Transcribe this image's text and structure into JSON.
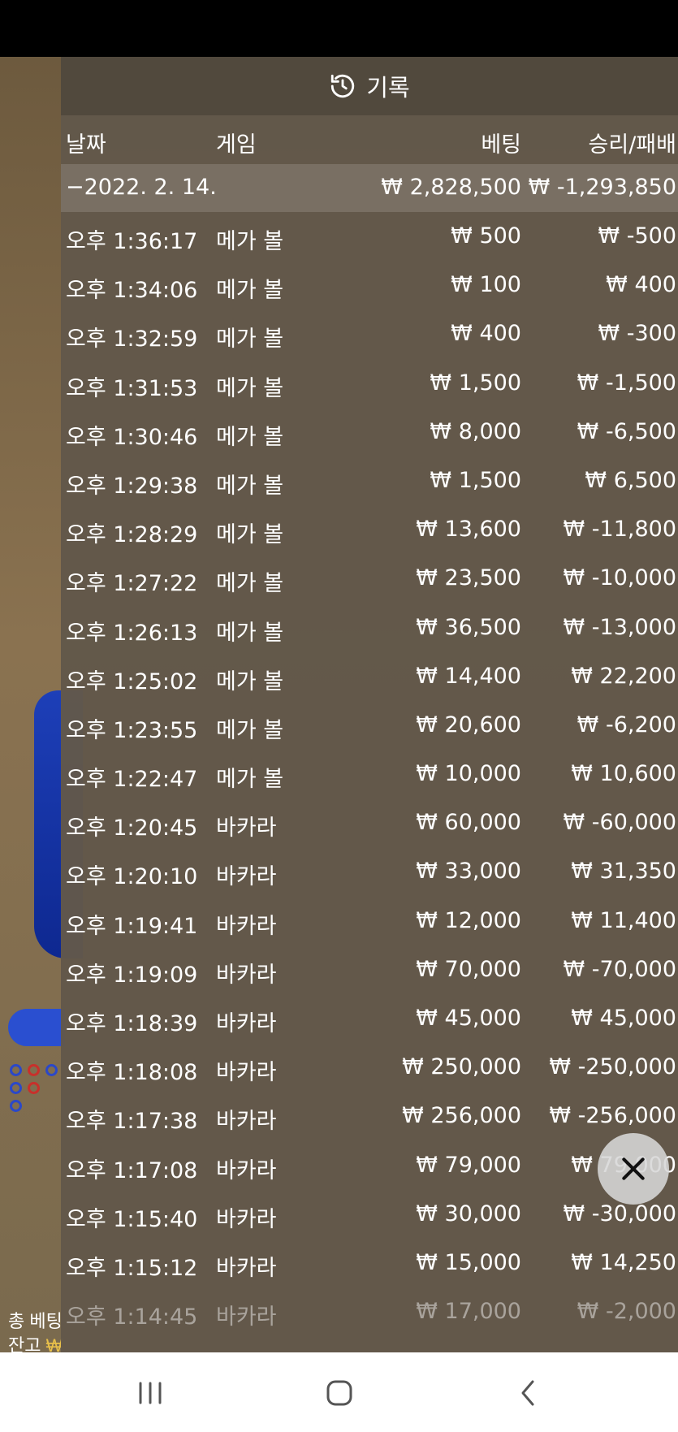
{
  "header": {
    "title": "기록",
    "icon": "history-icon"
  },
  "columns": {
    "date": "날짜",
    "game": "게임",
    "bet": "베팅",
    "win_loss": "승리/패배"
  },
  "summary": {
    "date": "−2022. 2. 14.",
    "bet": "₩ 2,828,500",
    "win_loss": "₩ -1,293,850"
  },
  "rows": [
    {
      "time": "오후 1:36:17",
      "game": "메가 볼",
      "bet": "₩ 500",
      "win_loss": "₩ -500"
    },
    {
      "time": "오후 1:34:06",
      "game": "메가 볼",
      "bet": "₩ 100",
      "win_loss": "₩ 400"
    },
    {
      "time": "오후 1:32:59",
      "game": "메가 볼",
      "bet": "₩ 400",
      "win_loss": "₩ -300"
    },
    {
      "time": "오후 1:31:53",
      "game": "메가 볼",
      "bet": "₩ 1,500",
      "win_loss": "₩ -1,500"
    },
    {
      "time": "오후 1:30:46",
      "game": "메가 볼",
      "bet": "₩ 8,000",
      "win_loss": "₩ -6,500"
    },
    {
      "time": "오후 1:29:38",
      "game": "메가 볼",
      "bet": "₩ 1,500",
      "win_loss": "₩ 6,500"
    },
    {
      "time": "오후 1:28:29",
      "game": "메가 볼",
      "bet": "₩ 13,600",
      "win_loss": "₩ -11,800"
    },
    {
      "time": "오후 1:27:22",
      "game": "메가 볼",
      "bet": "₩ 23,500",
      "win_loss": "₩ -10,000"
    },
    {
      "time": "오후 1:26:13",
      "game": "메가 볼",
      "bet": "₩ 36,500",
      "win_loss": "₩ -13,000"
    },
    {
      "time": "오후 1:25:02",
      "game": "메가 볼",
      "bet": "₩ 14,400",
      "win_loss": "₩ 22,200"
    },
    {
      "time": "오후 1:23:55",
      "game": "메가 볼",
      "bet": "₩ 20,600",
      "win_loss": "₩ -6,200"
    },
    {
      "time": "오후 1:22:47",
      "game": "메가 볼",
      "bet": "₩ 10,000",
      "win_loss": "₩ 10,600"
    },
    {
      "time": "오후 1:20:45",
      "game": "바카라",
      "bet": "₩ 60,000",
      "win_loss": "₩ -60,000"
    },
    {
      "time": "오후 1:20:10",
      "game": "바카라",
      "bet": "₩ 33,000",
      "win_loss": "₩ 31,350"
    },
    {
      "time": "오후 1:19:41",
      "game": "바카라",
      "bet": "₩ 12,000",
      "win_loss": "₩ 11,400"
    },
    {
      "time": "오후 1:19:09",
      "game": "바카라",
      "bet": "₩ 70,000",
      "win_loss": "₩ -70,000"
    },
    {
      "time": "오후 1:18:39",
      "game": "바카라",
      "bet": "₩ 45,000",
      "win_loss": "₩ 45,000"
    },
    {
      "time": "오후 1:18:08",
      "game": "바카라",
      "bet": "₩ 250,000",
      "win_loss": "₩ -250,000"
    },
    {
      "time": "오후 1:17:38",
      "game": "바카라",
      "bet": "₩ 256,000",
      "win_loss": "₩ -256,000"
    },
    {
      "time": "오후 1:17:08",
      "game": "바카라",
      "bet": "₩ 79,000",
      "win_loss": "₩ 79,000"
    },
    {
      "time": "오후 1:15:40",
      "game": "바카라",
      "bet": "₩ 30,000",
      "win_loss": "₩ -30,000"
    },
    {
      "time": "오후 1:15:12",
      "game": "바카라",
      "bet": "₩ 15,000",
      "win_loss": "₩ 14,250"
    },
    {
      "time": "오후 1:14:45",
      "game": "바카라",
      "bet": "₩ 17,000",
      "win_loss": "₩ -2,000"
    }
  ],
  "background": {
    "footer_line1": "총 베팅",
    "footer_line2_label": "잔고",
    "footer_line2_value": "₩"
  },
  "close_button": {
    "icon": "close-icon"
  },
  "nav": {
    "recents_icon": "recents-icon",
    "home_icon": "home-icon",
    "back_icon": "back-icon"
  },
  "colors": {
    "panel": "#62584a",
    "gold": "#e8c04a",
    "blue": "#1d3fb8"
  }
}
